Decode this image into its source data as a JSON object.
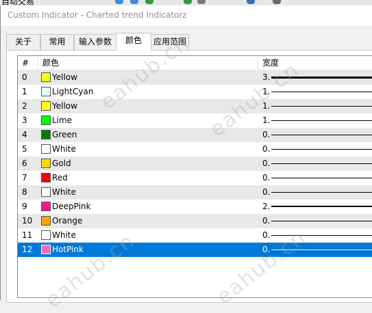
{
  "app_toolbar": {
    "visible_text": "自动交易"
  },
  "window": {
    "title": "Custom Indicator - Charted trend Indicatorz"
  },
  "tabs": [
    {
      "label": "关于"
    },
    {
      "label": "常用"
    },
    {
      "label": "输入参数"
    },
    {
      "label": "颜色"
    },
    {
      "label": "应用范围"
    }
  ],
  "active_tab": "颜色",
  "grid": {
    "columns": {
      "index": "#",
      "color": "颜色",
      "width": "宽度"
    },
    "rows": [
      {
        "index": "0",
        "color_name": "Yellow",
        "color": "#ffff00",
        "width": "3.",
        "line_weight": 3
      },
      {
        "index": "1",
        "color_name": "LightCyan",
        "color": "#e0ffff",
        "width": "1.",
        "line_weight": 1
      },
      {
        "index": "2",
        "color_name": "Yellow",
        "color": "#ffff00",
        "width": "1.",
        "line_weight": 1
      },
      {
        "index": "3",
        "color_name": "Lime",
        "color": "#00ff00",
        "width": "1.",
        "line_weight": 1
      },
      {
        "index": "4",
        "color_name": "Green",
        "color": "#008000",
        "width": "0.",
        "line_weight": 1
      },
      {
        "index": "5",
        "color_name": "White",
        "color": "#ffffff",
        "width": "0.",
        "line_weight": 1
      },
      {
        "index": "6",
        "color_name": "Gold",
        "color": "#ffd700",
        "width": "0.",
        "line_weight": 1
      },
      {
        "index": "7",
        "color_name": "Red",
        "color": "#ff0000",
        "width": "0.",
        "line_weight": 1
      },
      {
        "index": "8",
        "color_name": "White",
        "color": "#ffffff",
        "width": "0.",
        "line_weight": 1
      },
      {
        "index": "9",
        "color_name": "DeepPink",
        "color": "#ff1493",
        "width": "2.",
        "line_weight": 2
      },
      {
        "index": "10",
        "color_name": "Orange",
        "color": "#ffa500",
        "width": "0.",
        "line_weight": 1
      },
      {
        "index": "11",
        "color_name": "White",
        "color": "#ffffff",
        "width": "0.",
        "line_weight": 1
      },
      {
        "index": "12",
        "color_name": "HotPink",
        "color": "#ff69b4",
        "width": "0.",
        "line_weight": 1
      }
    ],
    "selected_index": "12"
  },
  "watermark": {
    "text": "eahub.cn"
  },
  "colors": {
    "selection": "#0078d7",
    "alt_row": "#e8e8e8"
  }
}
